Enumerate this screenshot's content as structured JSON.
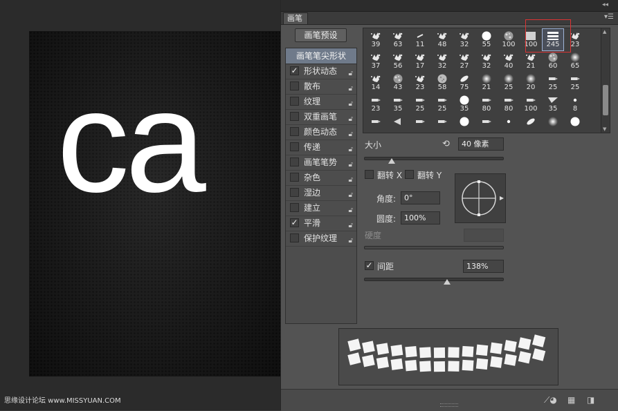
{
  "canvas": {
    "text": "ca"
  },
  "watermark": "思缘设计论坛 www.MISSYUAN.COM",
  "panel": {
    "tab_label": "画笔",
    "collapse_glyph": "◂◂",
    "menu_glyph": "▾☰",
    "preset_button": "画笔预设",
    "tip_shape_header": "画笔笔尖形状",
    "options": [
      {
        "label": "形状动态",
        "checked": true
      },
      {
        "label": "散布",
        "checked": false
      },
      {
        "label": "纹理",
        "checked": false
      },
      {
        "label": "双重画笔",
        "checked": false
      },
      {
        "label": "颜色动态",
        "checked": false
      },
      {
        "label": "传递",
        "checked": false
      },
      {
        "label": "画笔笔势",
        "checked": false
      },
      {
        "label": "杂色",
        "checked": false
      },
      {
        "label": "湿边",
        "checked": false
      },
      {
        "label": "建立",
        "checked": false
      },
      {
        "label": "平滑",
        "checked": true
      },
      {
        "label": "保护纹理",
        "checked": false
      }
    ],
    "brush_rows": [
      [
        {
          "n": "39",
          "k": "splat"
        },
        {
          "n": "63",
          "k": "splat"
        },
        {
          "n": "11",
          "k": "dash"
        },
        {
          "n": "48",
          "k": "splat"
        },
        {
          "n": "32",
          "k": "splat"
        },
        {
          "n": "55",
          "k": "circle"
        },
        {
          "n": "100",
          "k": "noise"
        },
        {
          "n": "100",
          "k": "square"
        },
        {
          "n": "245",
          "k": "bars"
        },
        {
          "n": "23",
          "k": "splat"
        }
      ],
      [
        {
          "n": "37",
          "k": "splat"
        },
        {
          "n": "56",
          "k": "splat"
        },
        {
          "n": "17",
          "k": "splat"
        },
        {
          "n": "32",
          "k": "splat"
        },
        {
          "n": "27",
          "k": "splat"
        },
        {
          "n": "32",
          "k": "splat"
        },
        {
          "n": "40",
          "k": "splat"
        },
        {
          "n": "21",
          "k": "splat"
        },
        {
          "n": "60",
          "k": "noise"
        },
        {
          "n": "65",
          "k": "soft"
        }
      ],
      [
        {
          "n": "14",
          "k": "splat"
        },
        {
          "n": "43",
          "k": "noise"
        },
        {
          "n": "23",
          "k": "splat"
        },
        {
          "n": "58",
          "k": "ball"
        },
        {
          "n": "75",
          "k": "leaf"
        },
        {
          "n": "21",
          "k": "soft"
        },
        {
          "n": "25",
          "k": "soft"
        },
        {
          "n": "20",
          "k": "soft"
        },
        {
          "n": "25",
          "k": "pencil"
        },
        {
          "n": "25",
          "k": "pencil"
        }
      ],
      [
        {
          "n": "23",
          "k": "pencil"
        },
        {
          "n": "35",
          "k": "pencil"
        },
        {
          "n": "25",
          "k": "pencil"
        },
        {
          "n": "25",
          "k": "pencil"
        },
        {
          "n": "35",
          "k": "circle"
        },
        {
          "n": "80",
          "k": "pencil"
        },
        {
          "n": "80",
          "k": "pencil"
        },
        {
          "n": "100",
          "k": "pencil"
        },
        {
          "n": "35",
          "k": "wedge"
        },
        {
          "n": "8",
          "k": "dot"
        }
      ],
      [
        {
          "n": "",
          "k": "pencil"
        },
        {
          "n": "",
          "k": "horn"
        },
        {
          "n": "",
          "k": "pencil"
        },
        {
          "n": "",
          "k": "pencil"
        },
        {
          "n": "",
          "k": "circle"
        },
        {
          "n": "",
          "k": "pencil"
        },
        {
          "n": "",
          "k": "dot"
        },
        {
          "n": "",
          "k": "leaf"
        },
        {
          "n": "",
          "k": "soft"
        },
        {
          "n": "",
          "k": "circle"
        }
      ]
    ],
    "size": {
      "label": "大小",
      "value": "40 像素",
      "fraction": 0.2
    },
    "flip_x": {
      "label": "翻转 X",
      "checked": false
    },
    "flip_y": {
      "label": "翻转 Y",
      "checked": false
    },
    "angle": {
      "label": "角度:",
      "value": "0°"
    },
    "roundness": {
      "label": "圆度:",
      "value": "100%"
    },
    "hardness": {
      "label": "硬度"
    },
    "spacing": {
      "label": "间距",
      "value": "138%",
      "checked": true,
      "fraction": 0.6
    }
  }
}
